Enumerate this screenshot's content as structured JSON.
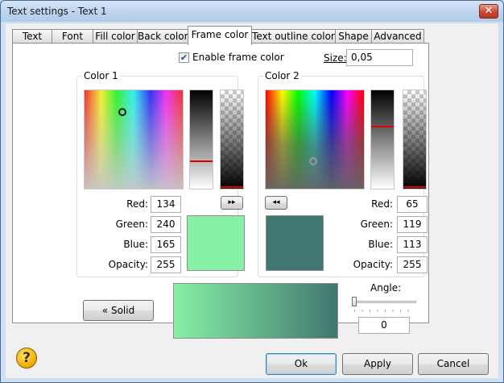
{
  "window": {
    "title": "Text settings - Text 1",
    "close_glyph": "✕"
  },
  "tabs": [
    {
      "label": "Text",
      "active": false
    },
    {
      "label": "Font",
      "active": false
    },
    {
      "label": "Fill color",
      "active": false
    },
    {
      "label": "Back color",
      "active": false
    },
    {
      "label": "Frame color",
      "active": true
    },
    {
      "label": "Text outline color",
      "active": false
    },
    {
      "label": "Shape",
      "active": false
    },
    {
      "label": "Advanced",
      "active": false
    }
  ],
  "frame": {
    "enable_label": "Enable frame color",
    "enabled": true,
    "size_label": "Size:",
    "size_value": "0,05"
  },
  "color1": {
    "title": "Color 1",
    "red_label": "Red:",
    "red": "134",
    "green_label": "Green:",
    "green": "240",
    "blue_label": "Blue:",
    "blue": "165",
    "opacity_label": "Opacity:",
    "opacity": "255",
    "hex": "#86f0a5",
    "copy_button_glyph": "▸▸"
  },
  "color2": {
    "title": "Color 2",
    "red_label": "Red:",
    "red": "65",
    "green_label": "Green:",
    "green": "119",
    "blue_label": "Blue:",
    "blue": "113",
    "opacity_label": "Opacity:",
    "opacity": "255",
    "hex": "#417771",
    "copy_button_glyph": "◂◂"
  },
  "gradient": {
    "solid_button": "« Solid",
    "angle_label": "Angle:",
    "angle_value": "0"
  },
  "footer": {
    "ok": "Ok",
    "apply": "Apply",
    "cancel": "Cancel",
    "help_glyph": "?"
  },
  "colors": {
    "accent": "#3c7fb1",
    "marker": "#e00000"
  }
}
